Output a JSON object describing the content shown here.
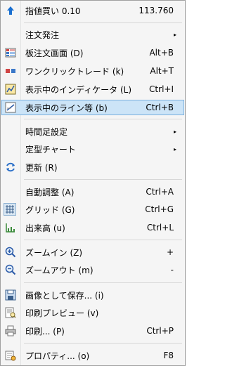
{
  "menu": {
    "items": [
      {
        "label": "指値買い 0.10",
        "shortcut": "113.760",
        "icon": "buy-limit-arrow-icon"
      },
      {
        "label": "注文発注",
        "shortcut": "",
        "submenu": true,
        "icon": ""
      },
      {
        "label": "板注文画面 (D)",
        "shortcut": "Alt+B",
        "icon": "order-book-icon"
      },
      {
        "label": "ワンクリックトレード (k)",
        "shortcut": "Alt+T",
        "icon": "one-click-trade-icon"
      },
      {
        "label": "表示中のインディケータ (L)",
        "shortcut": "Ctrl+I",
        "icon": "indicators-icon"
      },
      {
        "label": "表示中のライン等 (b)",
        "shortcut": "Ctrl+B",
        "icon": "objects-icon"
      },
      {
        "label": "時間足設定",
        "shortcut": "",
        "submenu": true,
        "icon": ""
      },
      {
        "label": "定型チャート",
        "shortcut": "",
        "submenu": true,
        "icon": ""
      },
      {
        "label": "更新 (R)",
        "shortcut": "",
        "icon": "refresh-icon"
      },
      {
        "label": "自動調整 (A)",
        "shortcut": "Ctrl+A",
        "icon": ""
      },
      {
        "label": "グリッド (G)",
        "shortcut": "Ctrl+G",
        "icon": "grid-icon"
      },
      {
        "label": "出来高 (u)",
        "shortcut": "Ctrl+L",
        "icon": "volume-icon"
      },
      {
        "label": "ズームイン (Z)",
        "shortcut": "+",
        "icon": "zoom-in-icon"
      },
      {
        "label": "ズームアウト (m)",
        "shortcut": "-",
        "icon": "zoom-out-icon"
      },
      {
        "label": "画像として保存... (i)",
        "shortcut": "",
        "icon": "save-image-icon"
      },
      {
        "label": "印刷プレビュー (v)",
        "shortcut": "",
        "icon": "print-preview-icon"
      },
      {
        "label": "印刷... (P)",
        "shortcut": "Ctrl+P",
        "icon": "print-icon"
      },
      {
        "label": "プロパティ... (o)",
        "shortcut": "F8",
        "icon": "properties-icon"
      }
    ],
    "submenu_arrow": "▸",
    "highlight_color": "#cce4f7"
  }
}
